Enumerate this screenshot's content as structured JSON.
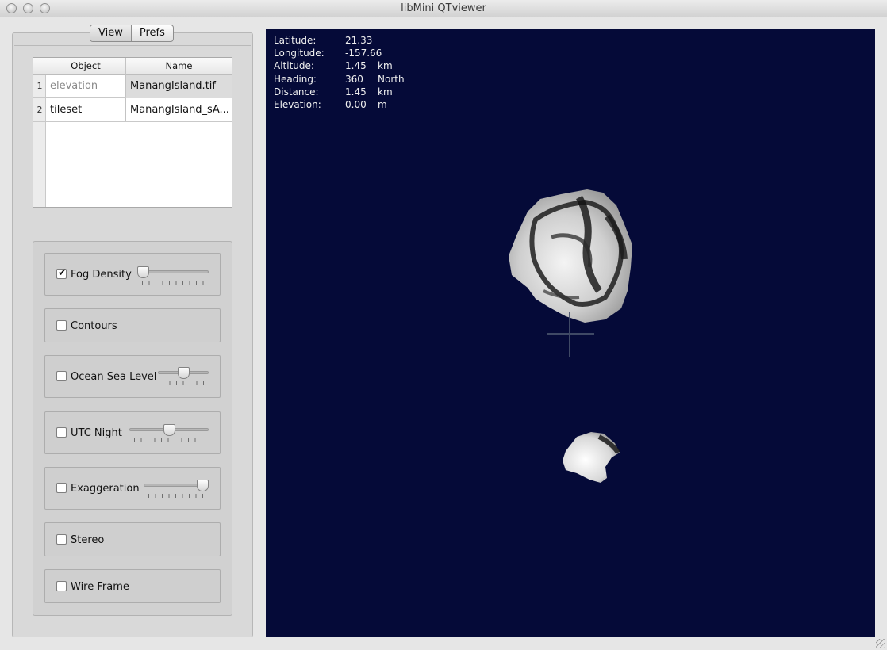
{
  "window": {
    "title": "libMini QTviewer"
  },
  "tabs": [
    {
      "label": "View",
      "active": true
    },
    {
      "label": "Prefs",
      "active": false
    }
  ],
  "table": {
    "headers": {
      "object": "Object",
      "name": "Name"
    },
    "rows": [
      {
        "num": "1",
        "object": "elevation",
        "name": "ManangIsland.tif"
      },
      {
        "num": "2",
        "object": "tileset",
        "name": "ManangIsland_sA..."
      }
    ]
  },
  "controls": {
    "fog": {
      "label": "Fog Density",
      "checked": true,
      "level": 0.0
    },
    "contours": {
      "label": "Contours",
      "checked": false
    },
    "ocean": {
      "label": "Ocean Sea Level",
      "checked": false,
      "level": 0.5
    },
    "utc": {
      "label": "UTC Night",
      "checked": false,
      "level": 0.5
    },
    "exaggeration": {
      "label": "Exaggeration",
      "checked": false,
      "level": 1.0
    },
    "stereo": {
      "label": "Stereo",
      "checked": false
    },
    "wireframe": {
      "label": "Wire Frame",
      "checked": false
    }
  },
  "hud": {
    "latitude": {
      "label": "Latitude:",
      "value": "21.33",
      "unit": ""
    },
    "longitude": {
      "label": "Longitude:",
      "value": "-157.66",
      "unit": ""
    },
    "altitude": {
      "label": "Altitude:",
      "value": "1.45",
      "unit": "km"
    },
    "heading": {
      "label": "Heading:",
      "value": "360",
      "unit": "North"
    },
    "distance": {
      "label": "Distance:",
      "value": "1.45",
      "unit": "km"
    },
    "elevation": {
      "label": "Elevation:",
      "value": "0.00",
      "unit": "m"
    }
  },
  "colors": {
    "ocean": "#050a38",
    "panel": "#d9d9d9"
  }
}
